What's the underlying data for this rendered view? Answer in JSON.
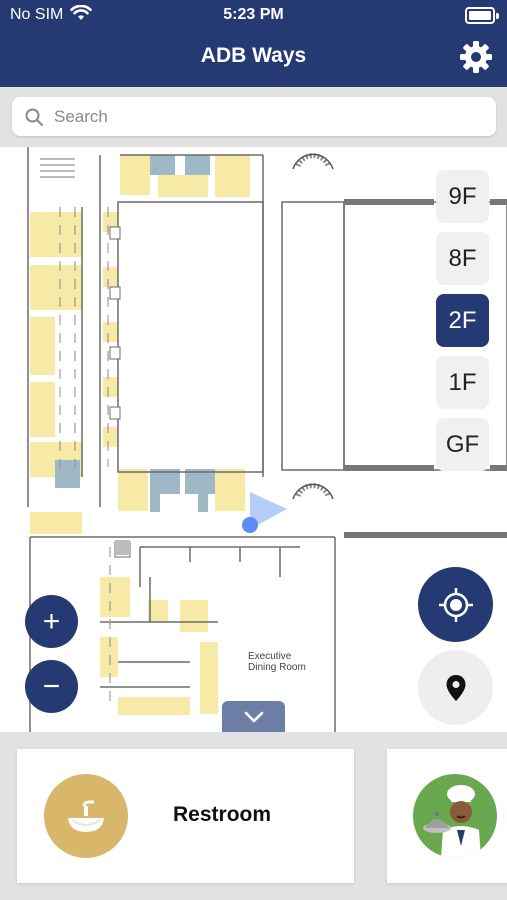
{
  "status_bar": {
    "carrier": "No SIM",
    "time": "5:23 PM"
  },
  "header": {
    "title": "ADB Ways"
  },
  "search": {
    "placeholder": "Search"
  },
  "map": {
    "room_label": "Executive Dining Room",
    "room_label_line1": "Executive",
    "room_label_line2": "Dining Room"
  },
  "floors": [
    {
      "label": "9F",
      "active": false
    },
    {
      "label": "8F",
      "active": false
    },
    {
      "label": "2F",
      "active": true
    },
    {
      "label": "1F",
      "active": false
    },
    {
      "label": "GF",
      "active": false
    }
  ],
  "controls": {
    "zoom_in": "+",
    "zoom_out": "−"
  },
  "categories": [
    {
      "label": "Restroom",
      "icon": "restroom-sink-icon"
    },
    {
      "label": "",
      "icon": "dining-chef-icon"
    }
  ],
  "colors": {
    "brand": "#253a73",
    "room_fill": "#f7e9a6",
    "room_fill_blue": "#9fb8c6",
    "restroom_circle": "#d8b76a",
    "dining_circle": "#6aa84f",
    "location_dot": "#5b8cf2"
  }
}
